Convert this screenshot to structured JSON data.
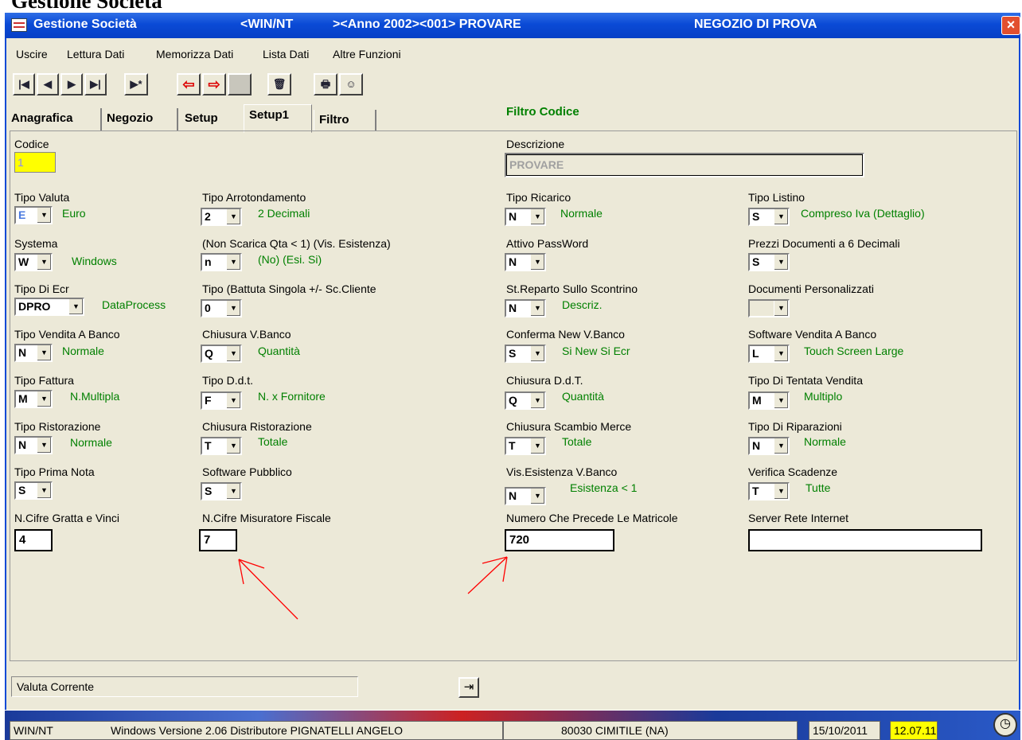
{
  "page_header": "Gestione Società",
  "window": {
    "title": "Gestione Società",
    "os": "<WIN/NT",
    "context": "><Anno 2002><001> PROVARE",
    "store": "NEGOZIO DI PROVA",
    "close": "×"
  },
  "menu": [
    "Uscire",
    "Lettura Dati",
    "Memorizza Dati",
    "Lista Dati",
    "Altre Funzioni"
  ],
  "toolbar": {
    "first": "|◀",
    "prev": "◀",
    "next": "▶",
    "last": "▶|",
    "new": "▶*",
    "back_arrow": "⇦",
    "fwd_arrow": "⇨",
    "blank": "",
    "delete": "🗑",
    "print": "🖶",
    "user": "☺"
  },
  "tabs": [
    "Anagrafica",
    "Negozio",
    "Setup",
    "Setup1",
    "Filtro"
  ],
  "filter_title": "Filtro Codice",
  "codice": {
    "label": "Codice",
    "value": "1"
  },
  "descrizione": {
    "label": "Descrizione",
    "value": "PROVARE"
  },
  "col1": [
    {
      "label": "Tipo Valuta",
      "value": "E",
      "desc": "Euro"
    },
    {
      "label": "Systema",
      "value": "W",
      "desc": "Windows"
    },
    {
      "label": "Tipo Di Ecr",
      "value": "DPRO",
      "desc": "DataProcess"
    },
    {
      "label": "Tipo Vendita A Banco",
      "value": "N",
      "desc": "Normale"
    },
    {
      "label": "Tipo Fattura",
      "value": "M",
      "desc": "N.Multipla"
    },
    {
      "label": "Tipo Ristorazione",
      "value": "N",
      "desc": "Normale"
    },
    {
      "label": "Tipo Prima Nota",
      "value": "S",
      "desc": ""
    }
  ],
  "col2": [
    {
      "label": "Tipo Arrotondamento",
      "value": "2",
      "desc": "2 Decimali"
    },
    {
      "label": "(Non Scarica Qta < 1) (Vis. Esistenza)",
      "value": "n",
      "desc": "(No) (Esi. Si)"
    },
    {
      "label": "Tipo (Battuta Singola +/- Sc.Cliente",
      "value": "0",
      "desc": ""
    },
    {
      "label": "Chiusura V.Banco",
      "value": "Q",
      "desc": "Quantità"
    },
    {
      "label": "Tipo D.d.t.",
      "value": "F",
      "desc": "N. x Fornitore"
    },
    {
      "label": "Chiusura Ristorazione",
      "value": "T",
      "desc": "Totale"
    },
    {
      "label": "Software Pubblico",
      "value": "S",
      "desc": ""
    }
  ],
  "col3": [
    {
      "label": "Tipo Ricarico",
      "value": "N",
      "desc": "Normale"
    },
    {
      "label": "Attivo PassWord",
      "value": "N",
      "desc": ""
    },
    {
      "label": "St.Reparto Sullo Scontrino",
      "value": "N",
      "desc": "Descriz."
    },
    {
      "label": "Conferma New V.Banco",
      "value": "S",
      "desc": "Si New Si Ecr"
    },
    {
      "label": "Chiusura D.d.T.",
      "value": "Q",
      "desc": "Quantità"
    },
    {
      "label": "Chiusura Scambio Merce",
      "value": "T",
      "desc": "Totale"
    },
    {
      "label": "Vis.Esistenza V.Banco",
      "value": "N",
      "desc": "Esistenza < 1"
    }
  ],
  "col4": [
    {
      "label": "Tipo Listino",
      "value": "S",
      "desc": "Compreso Iva (Dettaglio)"
    },
    {
      "label": "Prezzi Documenti a 6 Decimali",
      "value": "S",
      "desc": ""
    },
    {
      "label": "Documenti Personalizzati",
      "value": "",
      "desc": ""
    },
    {
      "label": "Software Vendita A Banco",
      "value": "L",
      "desc": "Touch Screen Large"
    },
    {
      "label": "Tipo Di Tentata Vendita",
      "value": "M",
      "desc": "Multiplo"
    },
    {
      "label": "Tipo Di Riparazioni",
      "value": "N",
      "desc": "Normale"
    },
    {
      "label": "Verifica Scadenze",
      "value": "T",
      "desc": "Tutte"
    }
  ],
  "bottom_fields": [
    {
      "label": "N.Cifre Gratta e Vinci",
      "value": "4"
    },
    {
      "label": "N.Cifre Misuratore Fiscale",
      "value": "7"
    },
    {
      "label": "Numero Che Precede Le Matricole",
      "value": "720"
    },
    {
      "label": "Server Rete Internet",
      "value": ""
    }
  ],
  "status": {
    "valuta": "Valuta Corrente"
  },
  "taskbar": {
    "os": "WIN/NT",
    "info": "Windows   Versione 2.06 Distributore PIGNATELLI ANGELO",
    "city": "80030 CIMITILE (NA)",
    "date": "15/10/2011",
    "time": "12.07.11"
  },
  "colors": {
    "accent_green": "#008000",
    "title_blue": "#0a4ad6",
    "codice_bg": "#ffff00",
    "annotation_red": "#ff0000"
  }
}
